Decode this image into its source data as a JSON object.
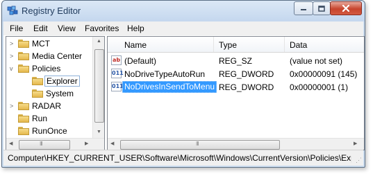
{
  "window": {
    "title": "Registry Editor",
    "close_glyph": "x",
    "min_glyph": "—"
  },
  "menu": [
    "File",
    "Edit",
    "View",
    "Favorites",
    "Help"
  ],
  "tree": {
    "items": [
      {
        "label": "MCT",
        "expander": ">"
      },
      {
        "label": "Media Center",
        "expander": ">"
      },
      {
        "label": "Policies",
        "expander": "v"
      },
      {
        "label": "Explorer",
        "expander": ""
      },
      {
        "label": "System",
        "expander": ""
      },
      {
        "label": "RADAR",
        "expander": ">"
      },
      {
        "label": "Run",
        "expander": ""
      },
      {
        "label": "RunOnce",
        "expander": ""
      }
    ]
  },
  "list": {
    "columns": [
      "Name",
      "Type",
      "Data"
    ],
    "rows": [
      {
        "icon": "ab",
        "name": "(Default)",
        "type": "REG_SZ",
        "data": "(value not set)"
      },
      {
        "icon": "011",
        "name": "NoDriveTypeAutoRun",
        "type": "REG_DWORD",
        "data": "0x00000091 (145)"
      },
      {
        "icon": "011",
        "name": "NoDrivesInSendToMenu",
        "type": "REG_DWORD",
        "data": "0x00000001 (1)"
      }
    ]
  },
  "scroll": {
    "grip": "III"
  },
  "status": {
    "path": "Computer\\HKEY_CURRENT_USER\\Software\\Microsoft\\Windows\\CurrentVersion\\Policies\\Exp"
  },
  "colors": {
    "selection": "#3399ff",
    "titlebar": "#c4d7ee",
    "close_button": "#c7452d"
  }
}
